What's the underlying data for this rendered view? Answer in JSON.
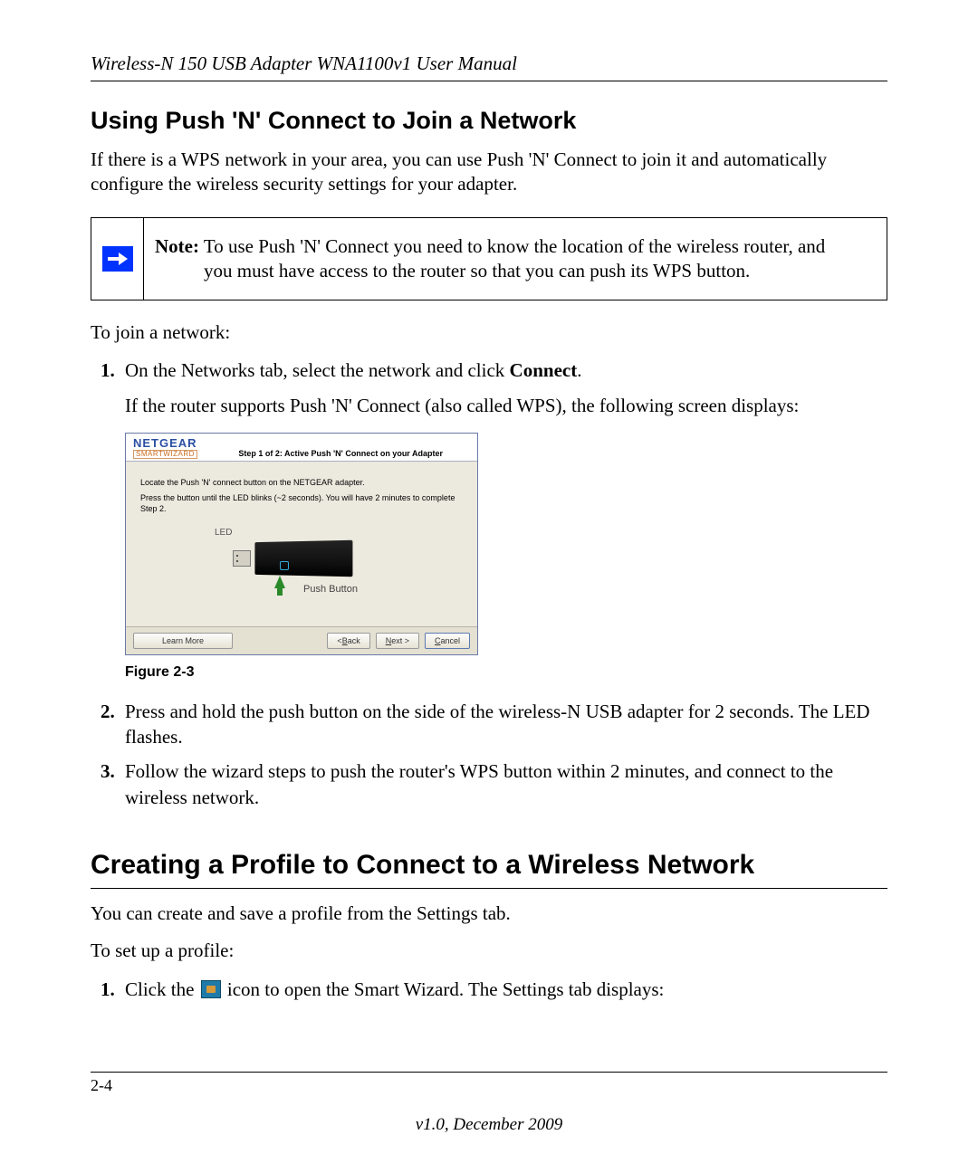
{
  "header": {
    "doc_title": "Wireless-N 150 USB Adapter WNA1100v1 User Manual"
  },
  "section1": {
    "title": "Using Push 'N' Connect to Join a Network",
    "intro": "If there is a WPS network in your area, you can use Push 'N' Connect to join it and automatically configure the wireless security settings for your adapter."
  },
  "note": {
    "label": "Note:",
    "line1_rest": " To use Push 'N' Connect you need to know the location of the wireless router, and",
    "line2": "you must have access to the router so that you can push its WPS button."
  },
  "join_intro": "To join a network:",
  "steps_a": {
    "s1_pre": "On the Networks tab, select the network and click ",
    "s1_bold": "Connect",
    "s1_post": ".",
    "s1_sub": "If the router supports Push 'N' Connect (also called WPS), the following screen displays:"
  },
  "wizard": {
    "brand": "NETGEAR",
    "brand_sub": "SMARTWIZARD",
    "step_title": "Step 1 of 2: Active Push 'N' Connect on your Adapter",
    "line1": "Locate the Push 'N' connect button on the NETGEAR adapter.",
    "line2": "Press the button until the LED blinks (~2 seconds). You will have 2 minutes to complete Step 2.",
    "led_label": "LED",
    "push_label": "Push Button",
    "buttons": {
      "learn_more": "Learn More",
      "back_pre": "<",
      "back_ul": "B",
      "back_post": "ack",
      "next_ul": "N",
      "next_post": "ext >",
      "cancel_ul": "C",
      "cancel_post": "ancel"
    }
  },
  "figure_caption": "Figure 2-3",
  "steps_b": {
    "s2": "Press and hold the push button on the side of the wireless-N USB adapter for 2 seconds. The LED flashes.",
    "s3": "Follow the wizard steps to push the router's WPS button within 2 minutes, and connect to the wireless network."
  },
  "section2": {
    "title": "Creating a Profile to Connect to a Wireless Network",
    "p1": "You can create and save a profile from the Settings tab.",
    "p2": "To set up a profile:",
    "step1_pre": "Click the ",
    "step1_post": " icon to open the Smart Wizard. The Settings tab displays:"
  },
  "footer": {
    "page_num": "2-4",
    "version": "v1.0, December 2009"
  }
}
